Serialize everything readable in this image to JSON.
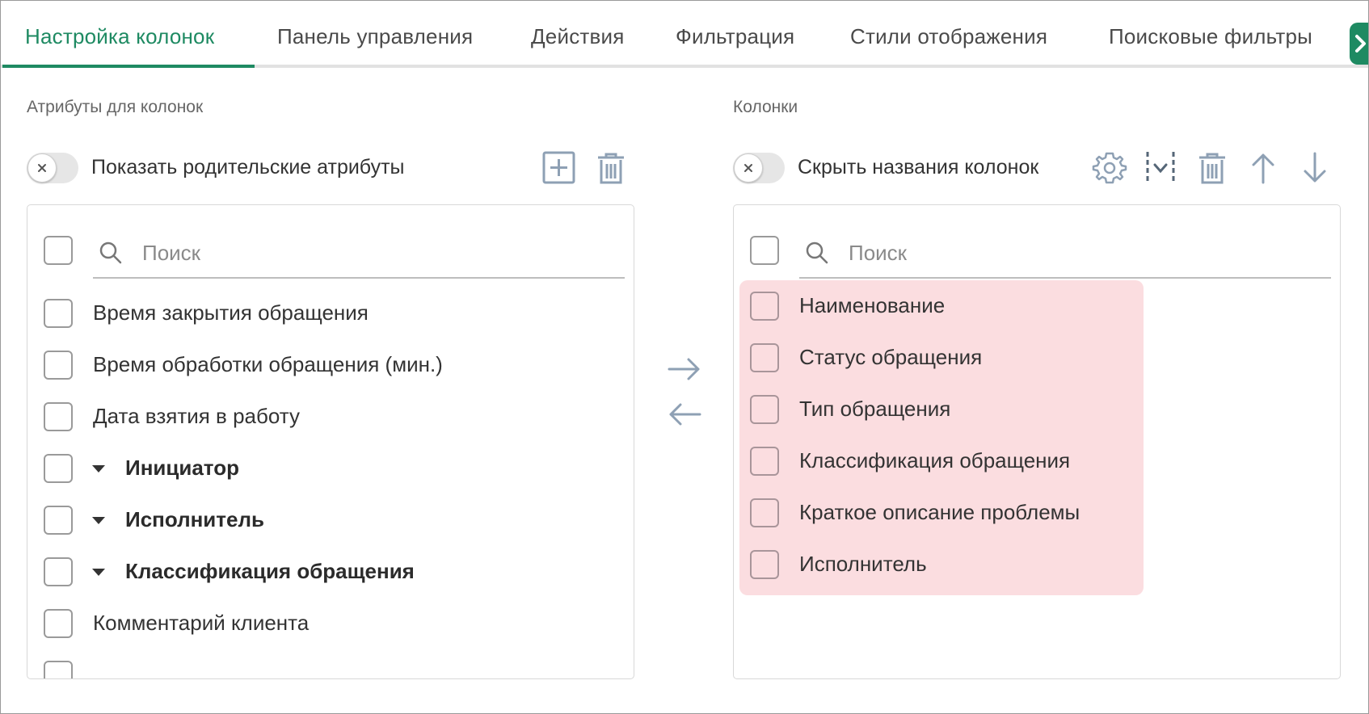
{
  "colors": {
    "accent": "#1e8a62",
    "highlight": "#fbdde0",
    "icon": "#8ea0b4",
    "border": "#d8d8d8"
  },
  "tabs": [
    {
      "label": "Настройка колонок",
      "active": true
    },
    {
      "label": "Панель управления",
      "active": false
    },
    {
      "label": "Действия",
      "active": false
    },
    {
      "label": "Фильтрация",
      "active": false
    },
    {
      "label": "Стили отображения",
      "active": false
    },
    {
      "label": "Поисковые фильтры",
      "active": false
    }
  ],
  "tab_scroll_icon": "chevron-right-icon",
  "left_panel": {
    "title": "Атрибуты для колонок",
    "toggle_label": "Показать родительские атрибуты",
    "toggle_on": false,
    "tools": [
      "add-square-icon",
      "trash-icon"
    ],
    "search_placeholder": "Поиск",
    "items": [
      {
        "label": "Время закрытия обращения",
        "expandable": false
      },
      {
        "label": "Время обработки обращения (мин.)",
        "expandable": false
      },
      {
        "label": "Дата взятия в работу",
        "expandable": false
      },
      {
        "label": "Инициатор",
        "expandable": true
      },
      {
        "label": "Исполнитель",
        "expandable": true
      },
      {
        "label": "Классификация обращения",
        "expandable": true
      },
      {
        "label": "Комментарий клиента",
        "expandable": false
      }
    ]
  },
  "transfer": {
    "move_right_icon": "arrow-right-icon",
    "move_left_icon": "arrow-left-icon"
  },
  "right_panel": {
    "title": "Колонки",
    "toggle_label": "Скрыть названия колонок",
    "toggle_on": false,
    "tools": [
      "gear-icon",
      "column-select-icon",
      "trash-icon",
      "arrow-up-icon",
      "arrow-down-icon"
    ],
    "search_placeholder": "Поиск",
    "items": [
      {
        "label": "Наименование"
      },
      {
        "label": "Статус обращения"
      },
      {
        "label": "Тип обращения"
      },
      {
        "label": "Классификация обращения"
      },
      {
        "label": "Краткое описание проблемы"
      },
      {
        "label": "Исполнитель"
      }
    ]
  }
}
